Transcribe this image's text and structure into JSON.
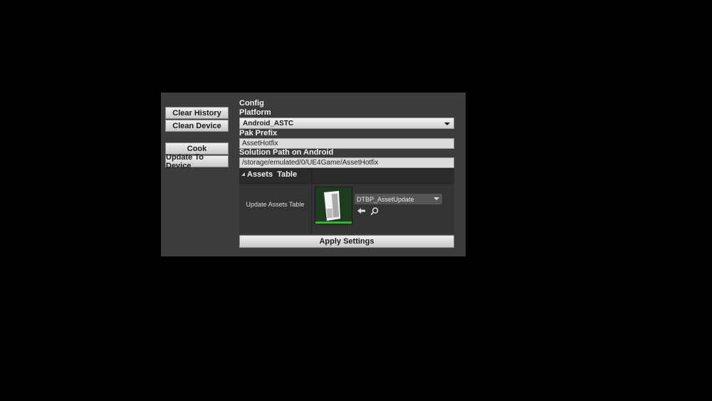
{
  "left_buttons": {
    "clear_history": "Clear History",
    "clean_device": "Clean Device",
    "cook": "Cook",
    "update_to_device": "Update To Device"
  },
  "config": {
    "title": "Config",
    "platform_label": "Platform",
    "platform_value": "Android_ASTC",
    "pak_prefix_label": "Pak Prefix",
    "pak_prefix_value": "AssetHotfix",
    "solution_path_label": "Solution Path on Android",
    "solution_path_value": "/storage/emulated/0/UE4Game/AssetHotfix"
  },
  "assets_table": {
    "header": "Assets  Table",
    "row_label": "Update Assets Table",
    "asset_value": "DTBP_AssetUpdate",
    "thumb_color": "#1f3b1f",
    "thumb_bar_color": "#3db13d"
  },
  "apply_button": "Apply Settings"
}
